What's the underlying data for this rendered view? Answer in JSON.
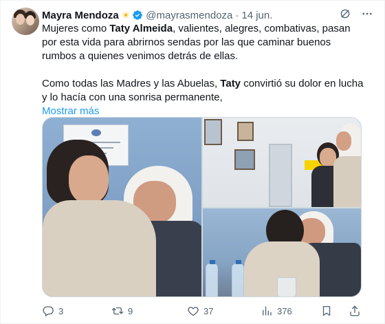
{
  "tweet": {
    "author": {
      "name": "Mayra Mendoza",
      "emoji": "☀",
      "verified": true,
      "handle": "@mayrasmendoza",
      "separator": "·",
      "date": "14 jun."
    },
    "body": {
      "p1_pre": "Mujeres como ",
      "p1_bold": "Taty Almeida",
      "p1_post": ", valientes, alegres, combativas, pasan por esta vida para abrirnos sendas por las que caminar buenos rumbos a quienes venimos detrás de ellas.",
      "p2_pre": "Como todas las Madres y las Abuelas, ",
      "p2_bold": "Taty",
      "p2_post": " convirtió su dolor en lucha y lo hacía con una sonrisa permanente,",
      "show_more": "Mostrar más"
    },
    "actions": {
      "replies": "3",
      "reposts": "9",
      "likes": "37",
      "views": "376"
    }
  },
  "colors": {
    "accent": "#1d9bf0",
    "text": "#0f1419",
    "muted": "#536471",
    "border": "#cfd9de"
  },
  "icons": {
    "verified": "verified-badge-icon",
    "grok": "grok-icon",
    "more": "more-icon",
    "reply": "reply-icon",
    "repost": "repost-icon",
    "like": "heart-icon",
    "views": "views-icon",
    "bookmark": "bookmark-icon",
    "share": "share-icon"
  }
}
